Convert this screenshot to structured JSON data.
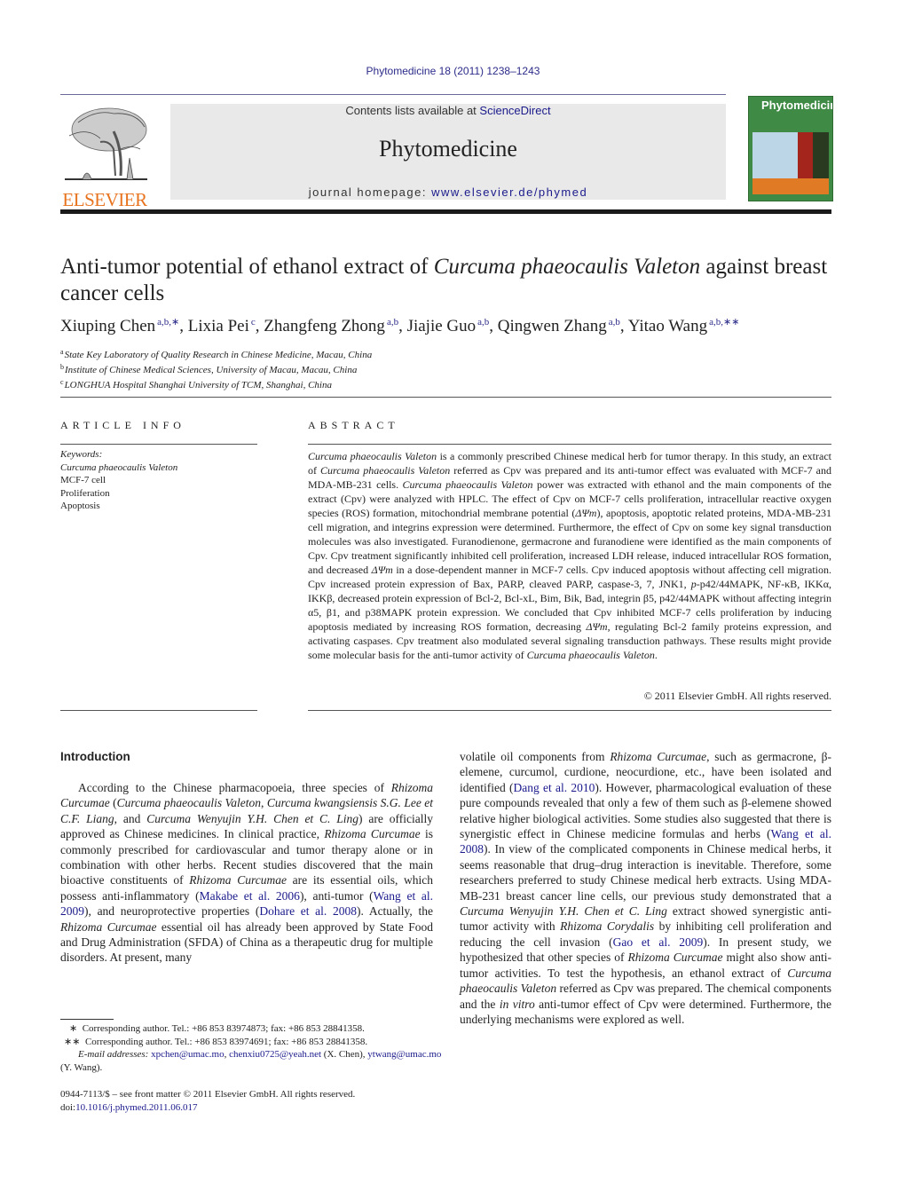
{
  "header": {
    "journal_ref": "Phytomedicine 18 (2011) 1238–1243",
    "contents_prefix": "Contents lists available at ",
    "contents_link": "ScienceDirect",
    "journal_title": "Phytomedicine",
    "homepage_prefix": "journal homepage: ",
    "homepage_link": "www.elsevier.de/phymed",
    "publisher_logo_text": "ELSEVIER",
    "cover_title": "Phytomedicine"
  },
  "colors": {
    "link": "#1a1a8c",
    "elsevier_orange": "#e8731f",
    "banner_bg": "#e9e9e9",
    "cover_green": "#3f8a45"
  },
  "article": {
    "title_part1": "Anti-tumor potential of ethanol extract of ",
    "title_italic": "Curcuma phaeocaulis Valeton",
    "title_part2": " against breast cancer cells",
    "authors": [
      {
        "name": "Xiuping Chen",
        "sup": "a,b,∗",
        "sep": ", "
      },
      {
        "name": "Lixia Pei",
        "sup": "c",
        "sep": ", "
      },
      {
        "name": "Zhangfeng Zhong",
        "sup": "a,b",
        "sep": ", "
      },
      {
        "name": "Jiajie Guo",
        "sup": "a,b",
        "sep": ", "
      },
      {
        "name": "Qingwen Zhang",
        "sup": "a,b",
        "sep": ", "
      },
      {
        "name": "Yitao Wang",
        "sup": "a,b,∗∗",
        "sep": ""
      }
    ],
    "affiliations": [
      {
        "mark": "a",
        "text": "State Key Laboratory of Quality Research in Chinese Medicine, Macau, China"
      },
      {
        "mark": "b",
        "text": "Institute of Chinese Medical Sciences, University of Macau, Macau, China"
      },
      {
        "mark": "c",
        "text": "LONGHUA Hospital Shanghai University of TCM, Shanghai, China"
      }
    ]
  },
  "article_info": {
    "heading": "ARTICLE INFO",
    "keywords_label": "Keywords:",
    "keywords": [
      "Curcuma phaeocaulis Valeton",
      "MCF-7 cell",
      "Proliferation",
      "Apoptosis"
    ]
  },
  "abstract": {
    "heading": "ABSTRACT",
    "s1_it": "Curcuma phaeocaulis Valeton",
    "s1": " is a commonly prescribed Chinese medical herb for tumor therapy. In this study, an extract of ",
    "s2_it": "Curcuma phaeocaulis Valeton",
    "s2": " referred as Cpv was prepared and its anti-tumor effect was evaluated with MCF-7 and MDA-MB-231 cells. ",
    "s3_it": "Curcuma phaeocaulis Valeton",
    "s3": " power was extracted with ethanol and the main components of the extract (Cpv) were analyzed with HPLC. The effect of Cpv on MCF-7 cells proliferation, intracellular reactive oxygen species (ROS) formation, mitochondrial membrane potential (",
    "s4_it": "ΔΨm",
    "s4": "), apoptosis, apoptotic related proteins, MDA-MB-231 cell migration, and integrins expression were determined. Furthermore, the effect of Cpv on some key signal transduction molecules was also investigated. Furanodienone, germacrone and furanodiene were identified as the main components of Cpv. Cpv treatment significantly inhibited cell proliferation, increased LDH release, induced intracellular ROS formation, and decreased ",
    "s5_it": "ΔΨm",
    "s5": " in a dose-dependent manner in MCF-7 cells. Cpv induced apoptosis without affecting cell migration. Cpv increased protein expression of Bax, PARP, cleaved PARP, caspase-3, 7, JNK1, ",
    "s6_it": "p",
    "s6": "-p42/44MAPK, NF-κB, IKKα, IKKβ, decreased protein expression of Bcl-2, Bcl-xL, Bim, Bik, Bad, integrin β5, p42/44MAPK without affecting integrin α5, β1, and p38MAPK protein expression. We concluded that Cpv inhibited MCF-7 cells proliferation by inducing apoptosis mediated by increasing ROS formation, decreasing ",
    "s7_it": "ΔΨm",
    "s7": ", regulating Bcl-2 family proteins expression, and activating caspases. Cpv treatment also modulated several signaling transduction pathways. These results might provide some molecular basis for the anti-tumor activity of ",
    "s8_it": "Curcuma phaeocaulis Valeton",
    "s8": ".",
    "copyright": "© 2011 Elsevier GmbH. All rights reserved."
  },
  "intro": {
    "heading": "Introduction",
    "c1": [
      {
        "t": "According to the Chinese pharmacopoeia, three species of "
      },
      {
        "t": "Rhizoma Curcumae",
        "i": true
      },
      {
        "t": " ("
      },
      {
        "t": "Curcuma phaeocaulis Valeton",
        "i": true
      },
      {
        "t": ", "
      },
      {
        "t": "Curcuma kwangsiensis S.G. Lee et C.F. Liang",
        "i": true
      },
      {
        "t": ", and "
      },
      {
        "t": "Curcuma Wenyujin Y.H. Chen et C. Ling",
        "i": true
      },
      {
        "t": ") are officially approved as Chinese medicines. In clinical practice, "
      },
      {
        "t": "Rhizoma Curcumae",
        "i": true
      },
      {
        "t": " is commonly prescribed for cardiovascular and tumor therapy alone or in combination with other herbs. Recent studies discovered that the main bioactive constituents of "
      },
      {
        "t": "Rhizoma Curcumae",
        "i": true
      },
      {
        "t": " are its essential oils, which possess anti-inflammatory ("
      },
      {
        "t": "Makabe et al. 2006",
        "c": true
      },
      {
        "t": "), anti-tumor ("
      },
      {
        "t": "Wang et al. 2009",
        "c": true
      },
      {
        "t": "), and neuroprotective properties ("
      },
      {
        "t": "Dohare et al. 2008",
        "c": true
      },
      {
        "t": "). Actually, the "
      },
      {
        "t": "Rhizoma Curcumae",
        "i": true
      },
      {
        "t": " essential oil has already been approved by State Food and Drug Administration (SFDA) of China as a therapeutic drug for multiple disorders. At present, many"
      }
    ],
    "c2": [
      {
        "t": "volatile oil components from "
      },
      {
        "t": "Rhizoma Curcumae",
        "i": true
      },
      {
        "t": ", such as germacrone, β-elemene, curcumol, curdione, neocurdione, etc., have been isolated and identified ("
      },
      {
        "t": "Dang et al. 2010",
        "c": true
      },
      {
        "t": "). However, pharmacological evaluation of these pure compounds revealed that only a few of them such as β-elemene showed relative higher biological activities. Some studies also suggested that there is synergistic effect in Chinese medicine formulas and herbs ("
      },
      {
        "t": "Wang et al. 2008",
        "c": true
      },
      {
        "t": "). In view of the complicated components in Chinese medical herbs, it seems reasonable that drug–drug interaction is inevitable. Therefore, some researchers preferred to study Chinese medical herb extracts. Using MDA-MB-231 breast cancer line cells, our previous study demonstrated that a "
      },
      {
        "t": "Curcuma Wenyujin Y.H. Chen et C. Ling",
        "i": true
      },
      {
        "t": " extract showed synergistic anti-tumor activity with "
      },
      {
        "t": "Rhizoma Corydalis",
        "i": true
      },
      {
        "t": " by inhibiting cell proliferation and reducing the cell invasion ("
      },
      {
        "t": "Gao et al. 2009",
        "c": true
      },
      {
        "t": "). In present study, we hypothesized that other species of "
      },
      {
        "t": "Rhizoma Curcumae",
        "i": true
      },
      {
        "t": " might also show anti-tumor activities. To test the hypothesis, an ethanol extract of "
      },
      {
        "t": "Curcuma phaeocaulis Valeton",
        "i": true
      },
      {
        "t": " referred as Cpv was prepared. The chemical components and the "
      },
      {
        "t": "in vitro",
        "i": true
      },
      {
        "t": " anti-tumor effect of Cpv were determined. Furthermore, the underlying mechanisms were explored as well."
      }
    ]
  },
  "footnotes": {
    "fn1_mark": "∗",
    "fn1": "Corresponding author. Tel.: +86 853 83974873; fax: +86 853 28841358.",
    "fn2_mark": "∗∗",
    "fn2": "Corresponding author. Tel.: +86 853 83974691; fax: +86 853 28841358.",
    "email_label": "E-mail addresses:",
    "email1": "xpchen@umac.mo",
    "email2": "chenxiu0725@yeah.net",
    "email12_owner": " (X. Chen),",
    "email3": "ytwang@umac.mo",
    "email3_owner": " (Y. Wang).",
    "issn": "0944-7113/$ – see front matter © 2011 Elsevier GmbH. All rights reserved.",
    "doi_prefix": "doi:",
    "doi": "10.1016/j.phymed.2011.06.017"
  }
}
